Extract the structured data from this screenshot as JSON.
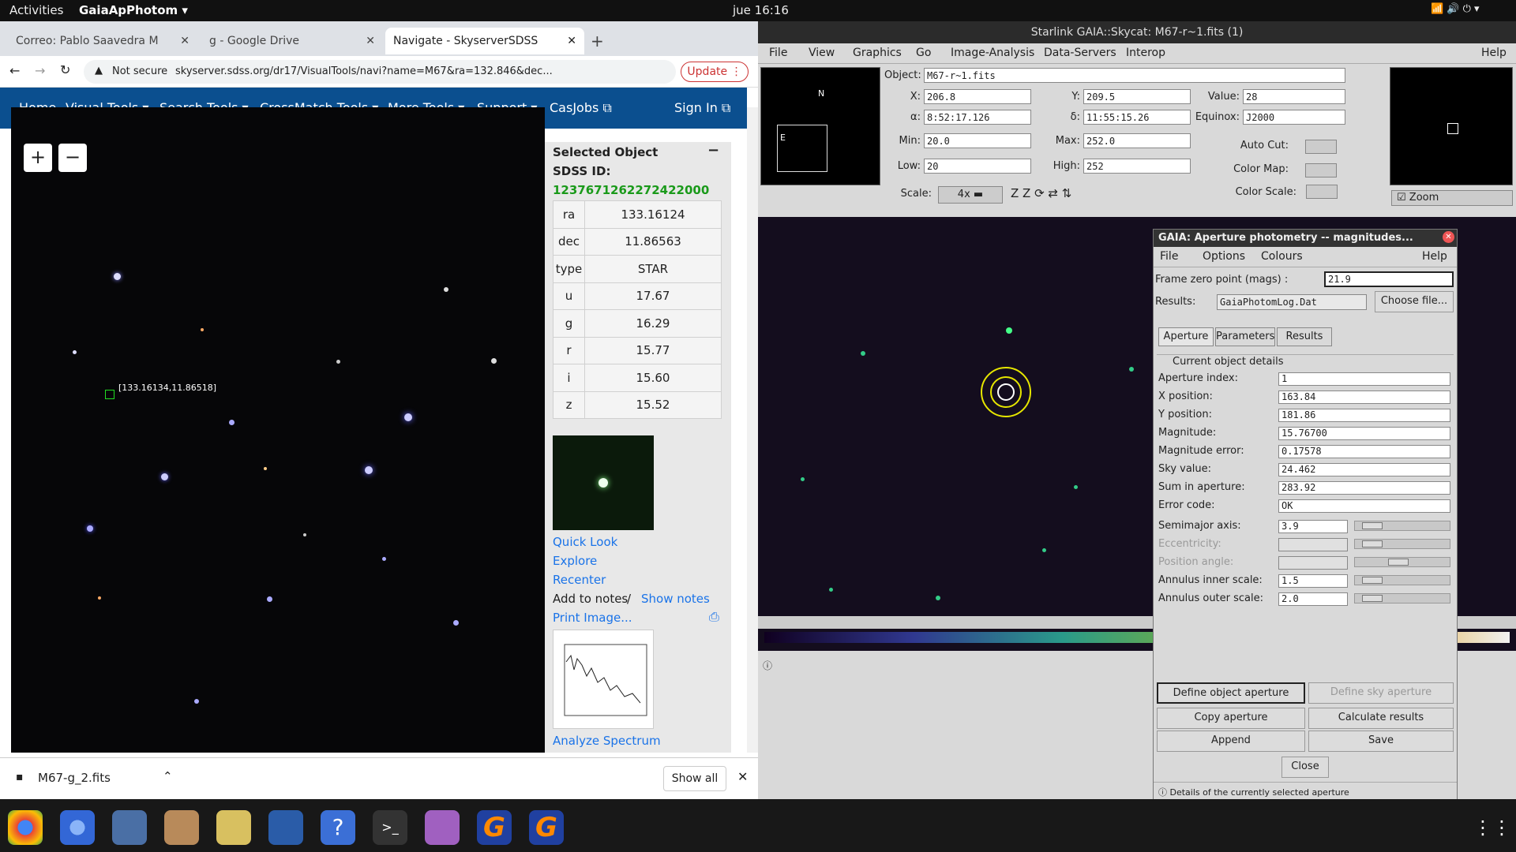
{
  "topbar": {
    "activities": "Activities",
    "app": "GaiaApPhotom",
    "clock": "jue 16:16"
  },
  "browser": {
    "tabs": [
      "Correo: Pablo Saavedra M",
      "g - Google Drive",
      "Navigate - SkyserverSDSS"
    ],
    "not_secure": "Not secure",
    "url": "skyserver.sdss.org/dr17/VisualTools/navi?name=M67&ra=132.846&dec...",
    "update": "Update",
    "nav": {
      "home": "Home",
      "visual": "Visual Tools",
      "search": "Search Tools",
      "crossmatch": "CrossMatch Tools",
      "more": "More Tools",
      "support": "Support",
      "casjobs": "CasJobs",
      "signin": "Sign In"
    },
    "marker": "[133.16134,11.86518]",
    "panel": {
      "title": "Selected Object",
      "sdss_label": "SDSS ID:",
      "sdss_id": "1237671262272422000",
      "rows": [
        [
          "ra",
          "133.16124"
        ],
        [
          "dec",
          "11.86563"
        ],
        [
          "type",
          "STAR"
        ],
        [
          "u",
          "17.67"
        ],
        [
          "g",
          "16.29"
        ],
        [
          "r",
          "15.77"
        ],
        [
          "i",
          "15.60"
        ],
        [
          "z",
          "15.52"
        ]
      ],
      "links": {
        "quick": "Quick Look",
        "explore": "Explore",
        "recenter": "Recenter",
        "addnotes": "Add to notes",
        "sep": "/",
        "shownotes": "Show notes",
        "print": "Print Image...",
        "analyze": "Analyze Spectrum"
      }
    },
    "download": {
      "file": "M67-g_2.fits",
      "showall": "Show all"
    }
  },
  "skycat": {
    "title": "Starlink GAIA::Skycat: M67-r~1.fits (1)",
    "menu": [
      "File",
      "View",
      "Graphics",
      "Go",
      "Image-Analysis",
      "Data-Servers",
      "Interop"
    ],
    "help": "Help",
    "object_label": "Object:",
    "object": "M67-r~1.fits",
    "x_label": "X:",
    "x": "206.8",
    "y_label": "Y:",
    "y": "209.5",
    "value_label": "Value:",
    "value": "28",
    "a_label": "α:",
    "alpha": "8:52:17.126",
    "d_label": "δ:",
    "delta": "11:55:15.26",
    "eq_label": "Equinox:",
    "equinox": "J2000",
    "min_label": "Min:",
    "min": "20.0",
    "max_label": "Max:",
    "max": "252.0",
    "low_label": "Low:",
    "low": "20",
    "high_label": "High:",
    "high": "252",
    "scale_label": "Scale:",
    "scale": "4x",
    "autocut": "Auto Cut:",
    "colormap": "Color Map:",
    "colorscale": "Color Scale:",
    "zoom": "Zoom",
    "compass_n": "N",
    "compass_e": "E"
  },
  "gaia": {
    "title": "GAIA: Aperture photometry -- magnitudes...",
    "menu": [
      "File",
      "Options",
      "Colours"
    ],
    "help": "Help",
    "zp_label": "Frame zero point (mags) :",
    "zp": "21.9",
    "results_label": "Results:",
    "results_file": "GaiaPhotomLog.Dat",
    "choose": "Choose file...",
    "tabs": [
      "Aperture",
      "Parameters",
      "Results"
    ],
    "section": "Current object details",
    "fields": [
      [
        "Aperture index:",
        "1"
      ],
      [
        "X position:",
        "163.84"
      ],
      [
        "Y position:",
        "181.86"
      ],
      [
        "Magnitude:",
        "15.76700"
      ],
      [
        "Magnitude error:",
        "0.17578"
      ],
      [
        "Sky value:",
        "24.462"
      ],
      [
        "Sum in aperture:",
        "283.92"
      ],
      [
        "Error code:",
        "OK"
      ]
    ],
    "sliders": [
      [
        "Semimajor axis:",
        "3.9",
        0.1
      ],
      [
        "Eccentricity:",
        "",
        0.1
      ],
      [
        "Position angle:",
        "",
        0.45
      ],
      [
        "Annulus inner scale:",
        "1.5",
        0.1
      ],
      [
        "Annulus outer scale:",
        "2.0",
        0.1
      ]
    ],
    "buttons": {
      "define_obj": "Define object aperture",
      "define_sky": "Define sky aperture",
      "copy": "Copy aperture",
      "calc": "Calculate results",
      "append": "Append",
      "save": "Save",
      "close": "Close"
    },
    "status": "Details of the currently selected aperture"
  }
}
